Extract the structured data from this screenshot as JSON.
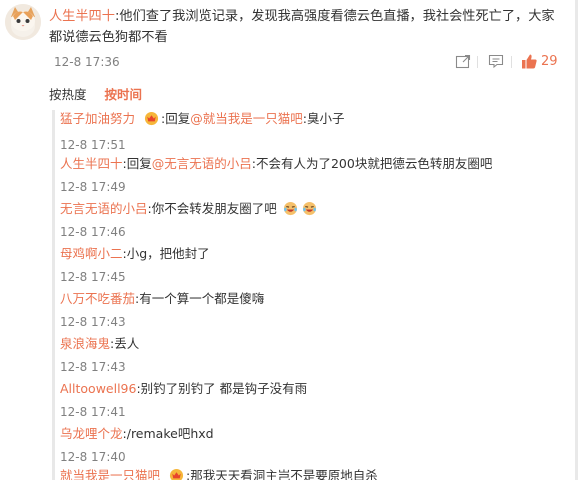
{
  "post": {
    "username": "人生半四十",
    "text": ":他们查了我浏览记录，发现我高强度看德云色直播，我社会性死亡了，大家都说德云色狗都不看",
    "time": "12-8 17:36",
    "like_count": "29"
  },
  "sort": {
    "hot_label": "按热度",
    "time_label": "按时间"
  },
  "replies": [
    {
      "user": "猛子加油努力",
      "text": ":回复",
      "mention": "@就当我是一只猫吧",
      "rest": ":臭小子",
      "time": "12-8 17:51"
    },
    {
      "user": "人生半四十",
      "text": ":回复",
      "mention": "@无言无语的小吕",
      "rest": ":不会有人为了200块就把德云色转朋友圈吧",
      "time": "12-8 17:49"
    },
    {
      "user": "无言无语的小吕",
      "text": ":你不会转发朋友圈了吧",
      "time": "12-8 17:46"
    },
    {
      "user": "母鸡啊小二",
      "text": ":小g，把他封了",
      "time": "12-8 17:45"
    },
    {
      "user": "八万不吃番茄",
      "text": ":有一个算一个都是傻嗨",
      "time": "12-8 17:43"
    },
    {
      "user": "泉浪海鬼",
      "text": ":丢人",
      "time": "12-8 17:43"
    },
    {
      "user": "Alltoowell96",
      "text": ":别钓了别钓了 都是钩子没有雨",
      "time": "12-8 17:41"
    },
    {
      "user": "乌龙哩个龙",
      "text": ":/remake吧hxd",
      "time": "12-8 17:40"
    },
    {
      "user": "就当我是一只猫吧",
      "text": ":那我天天看洞主岂不是要原地自杀"
    }
  ],
  "icons": {
    "share": "share-icon",
    "comment": "comment-icon",
    "like": "thumbs-up-icon",
    "badge": "crown-badge-icon",
    "emoji": "laugh-cry-emoji-icon"
  },
  "colors": {
    "accent": "#eb7350",
    "text": "#333333",
    "muted": "#808080"
  }
}
